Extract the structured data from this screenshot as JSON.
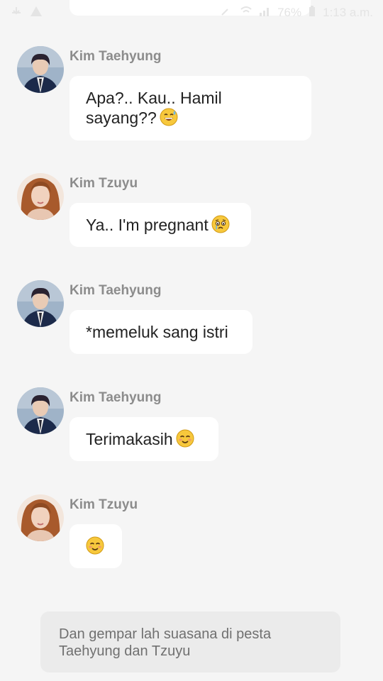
{
  "status_bar": {
    "time": "1:13 a.m.",
    "battery": "76%"
  },
  "messages": [
    {
      "sender": "Kim Taehyung",
      "text": "Apa?.. Kau.. Hamil sayang??",
      "emoji": "grinning-sweat-emoji"
    },
    {
      "sender": "Kim Tzuyu",
      "text": "Ya.. I'm pregnant",
      "emoji": "teary-emoji"
    },
    {
      "sender": "Kim Taehyung",
      "text": "*memeluk sang istri",
      "emoji": ""
    },
    {
      "sender": "Kim Taehyung",
      "text": "Terimakasih",
      "emoji": "smiling-blush-emoji"
    },
    {
      "sender": "Kim Tzuyu",
      "text": "",
      "emoji": "smiling-blush-emoji"
    }
  ],
  "narration": "Dan gempar lah suasana di pesta Taehyung dan Tzuyu",
  "colors": {
    "background": "#f5f5f5",
    "bubble": "#ffffff",
    "narration_bg": "#ebebeb",
    "sender_name": "#8c8c8c"
  }
}
